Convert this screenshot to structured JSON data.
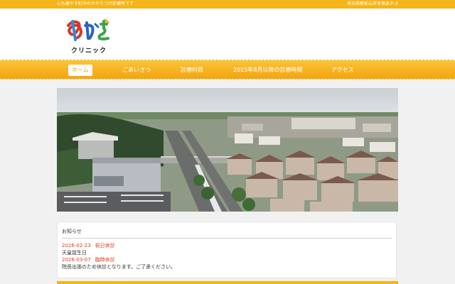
{
  "topbar": {
    "tagline": "心も癒やす町中のかかりつけ診療所です",
    "address": "埼玉県新松山市宮島あか-2"
  },
  "logo": {
    "name": "あかさ",
    "sub": "クリニック"
  },
  "nav": {
    "items": [
      {
        "label": "ホーム",
        "active": true
      },
      {
        "label": "ごあいさつ",
        "active": false
      },
      {
        "label": "診療科目",
        "active": false
      },
      {
        "label": "2015年8月以降の診療時間",
        "active": false
      },
      {
        "label": "アクセス",
        "active": false
      }
    ]
  },
  "news": {
    "title": "お知らせ",
    "entries": [
      {
        "date": "2026-02-23",
        "kind": "祝日休診",
        "body": "天皇誕生日"
      },
      {
        "date": "2026-03-07",
        "kind": "臨時休診",
        "body": "院長出張のため休診となります。ご了承ください。"
      }
    ]
  },
  "colors": {
    "accent": "#f5b419",
    "alert": "#e03a1e"
  }
}
